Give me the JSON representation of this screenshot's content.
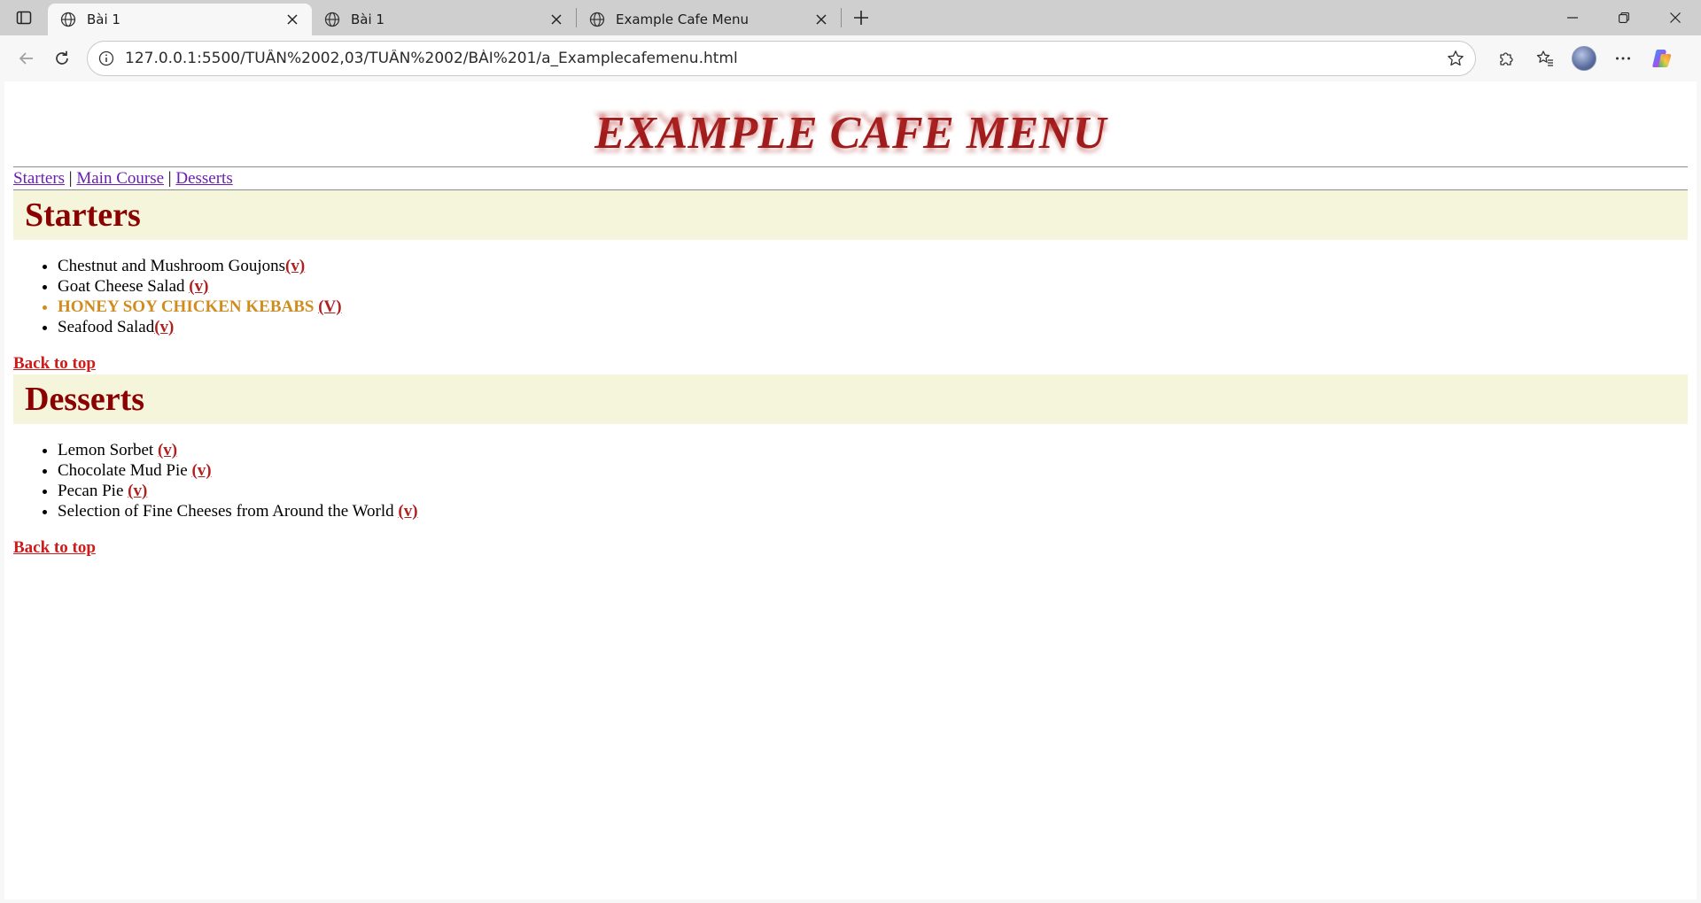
{
  "browser": {
    "tabs": [
      {
        "title": "Bài 1",
        "icon": "globe-icon",
        "active": true
      },
      {
        "title": "Bài 1",
        "icon": "globe-icon",
        "active": false
      },
      {
        "title": "Example Cafe Menu",
        "icon": "globe-icon",
        "active": false
      }
    ],
    "url": "127.0.0.1:5500/TUẦN%2002,03/TUẦN%2002/BÀI%201/a_Examplecafemenu.html"
  },
  "page": {
    "title": "EXAMPLE CAFE MENU",
    "nav": {
      "starters": "Starters",
      "sep1": " | ",
      "main_course": "Main Course",
      "sep2": " | ",
      "desserts": "Desserts"
    },
    "sections": {
      "starters": {
        "heading": "Starters",
        "items": [
          {
            "name": "Chestnut and Mushroom Goujons",
            "tag": "(v)"
          },
          {
            "name": "Goat Cheese Salad ",
            "tag": "(v)"
          },
          {
            "name": "HONEY SOY CHICKEN KEBABS ",
            "tag": "(V)"
          },
          {
            "name": "Seafood Salad",
            "tag": "(v)"
          }
        ],
        "back_to_top": "Back to top"
      },
      "desserts": {
        "heading": "Desserts",
        "items": [
          {
            "name": "Lemon Sorbet ",
            "tag": "(v)"
          },
          {
            "name": "Chocolate Mud Pie ",
            "tag": "(v)"
          },
          {
            "name": "Pecan Pie ",
            "tag": "(v)"
          },
          {
            "name": "Selection of Fine Cheeses from Around the World ",
            "tag": "(v)"
          }
        ],
        "back_to_top": "Back to top"
      }
    }
  },
  "colors": {
    "title": "#a01c1c",
    "section_bg": "#f5f5dc",
    "section_text": "#8b0000",
    "featured_item": "#d08c1e",
    "back_to_top": "#d11a1a",
    "nav_link": "#6a1fb0"
  }
}
